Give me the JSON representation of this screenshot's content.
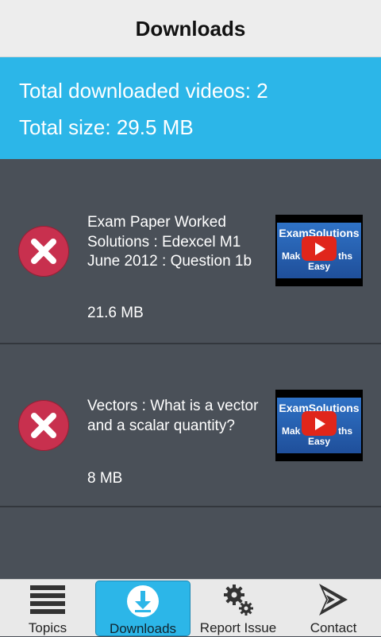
{
  "header": {
    "title": "Downloads"
  },
  "summary": {
    "total_videos": "Total downloaded videos: 2",
    "total_size": "Total size: 29.5 MB"
  },
  "downloads": [
    {
      "title": "Exam Paper Worked Solutions : Edexcel M1 June 2012 : Question 1b",
      "size": "21.6 MB",
      "thumbnail": {
        "brand": "ExamSolutions",
        "tag_left": "Mak",
        "tag_right": "ths",
        "tag_line2": "Easy"
      }
    },
    {
      "title": "Vectors : What is a vector and a scalar quantity?",
      "size": "8 MB",
      "thumbnail": {
        "brand": "ExamSolutions",
        "tag_left": "Mak",
        "tag_right": "ths",
        "tag_line2": "Easy"
      }
    }
  ],
  "tabs": [
    {
      "label": "Topics",
      "icon": "menu-icon"
    },
    {
      "label": "Downloads",
      "icon": "download-icon",
      "active": true
    },
    {
      "label": "Report Issue",
      "icon": "gears-icon"
    },
    {
      "label": "Contact",
      "icon": "contact-arrow-icon"
    }
  ],
  "colors": {
    "accent": "#2cb6e8",
    "delete": "#c8304e",
    "list_bg": "#4a5058",
    "play": "#e0261b"
  }
}
